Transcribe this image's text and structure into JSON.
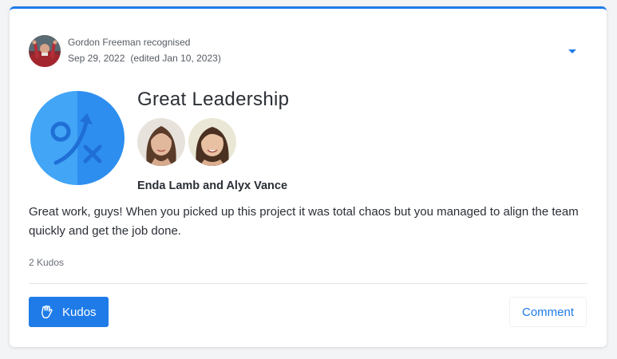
{
  "post": {
    "author_line": "Gordon Freeman recognised",
    "date": "Sep 29, 2022",
    "edited": "(edited Jan 10, 2023)"
  },
  "award": {
    "title": "Great Leadership",
    "recipients_label": "Enda Lamb and Alyx Vance"
  },
  "message": "Great work, guys! When you picked up this project it was total chaos but you managed to align the team quickly and get the job done.",
  "kudos_count": "2 Kudos",
  "actions": {
    "kudos_label": "Kudos",
    "comment_label": "Comment"
  },
  "colors": {
    "accent": "#1e7be8",
    "badge_light": "#42a5f5",
    "badge_dark": "#2e8ef0",
    "text": "#2b2f36",
    "muted": "#6b7079"
  },
  "icons": [
    "avatar",
    "leadership-badge-icon",
    "chevron-down-icon",
    "hand-wave-icon"
  ]
}
